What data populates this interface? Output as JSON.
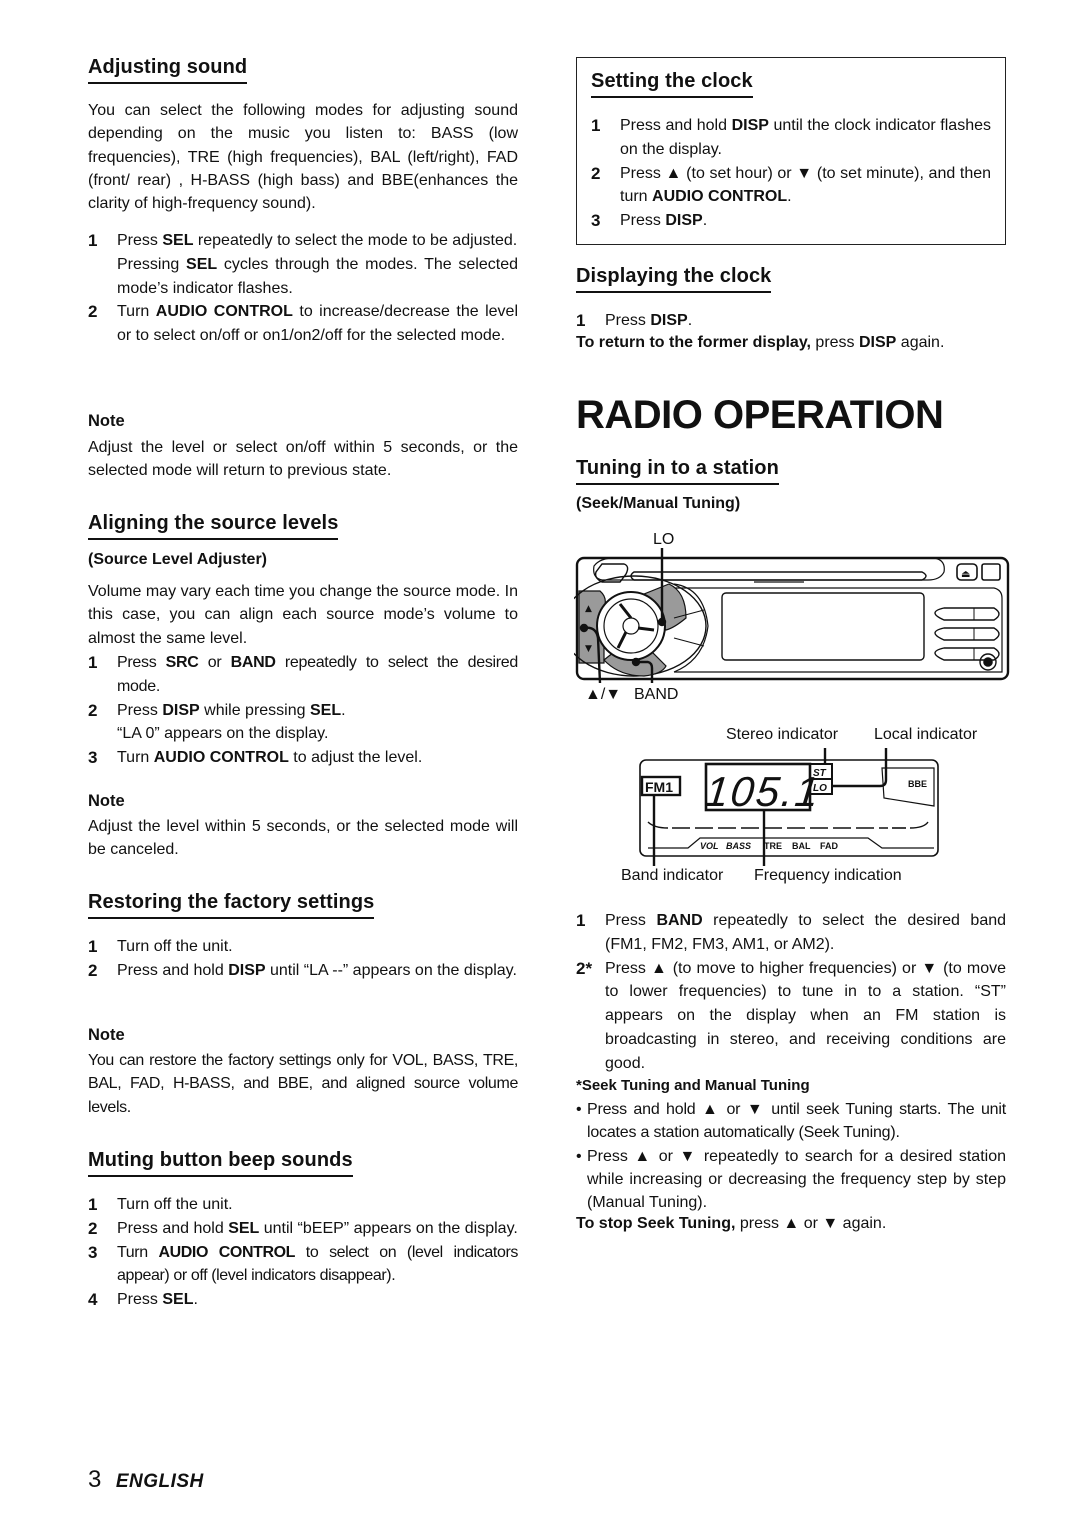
{
  "left": {
    "adjusting_sound": {
      "heading": "Adjusting sound",
      "intro": "You can select the following modes for adjusting sound depending on the music you listen to: BASS (low frequencies), TRE (high frequencies), BAL (left/right), FAD (front/ rear) , H-BASS (high bass) and BBE(enhances the clarity of high-frequency sound).",
      "steps": [
        {
          "num": "1",
          "pre": "Press ",
          "bold": "SEL",
          "post": " repeatedly to select the mode to be adjusted.",
          "extra_pre": "Pressing ",
          "extra_bold": "SEL",
          "extra_post": " cycles through the modes. The selected mode’s indicator flashes."
        },
        {
          "num": "2",
          "pre": "Turn ",
          "bold": "AUDIO CONTROL",
          "post": " to increase/decrease the level or to select on/off or on1/on2/off  for the selected mode."
        }
      ],
      "note_heading": "Note",
      "note_text": "Adjust the level or select on/off within 5 seconds, or the selected mode will return to previous state."
    },
    "aligning": {
      "heading": "Aligning the source levels",
      "subheading": "(Source Level Adjuster)",
      "intro": "Volume may vary each time you change the source mode. In this case, you can align each source mode’s volume to almost the same level.",
      "steps": [
        {
          "num": "1",
          "pre": "Press ",
          "bold": "SRC",
          "mid": " or ",
          "bold2": "BAND",
          "post": " repeatedly to select the desired mode."
        },
        {
          "num": "2",
          "pre": "Press ",
          "bold": "DISP",
          "mid": " while pressing ",
          "bold2": "SEL",
          "post": ".",
          "extra": "“LA 0” appears on the display."
        },
        {
          "num": "3",
          "pre": "Turn ",
          "bold": "AUDIO CONTROL",
          "post": " to adjust the level."
        }
      ],
      "note_heading": "Note",
      "note_text": "Adjust the level within 5 seconds, or the selected mode will be canceled."
    },
    "restoring": {
      "heading": "Restoring the factory settings",
      "steps": [
        {
          "num": "1",
          "text": "Turn off the unit."
        },
        {
          "num": "2",
          "pre": "Press and hold ",
          "bold": "DISP",
          "post": " until “LA --” appears on the display."
        }
      ],
      "note_heading": "Note",
      "note_text": "You can restore the factory settings only for VOL, BASS, TRE, BAL, FAD, H-BASS, and BBE, and aligned source volume levels."
    },
    "muting": {
      "heading": "Muting button beep sounds",
      "steps": [
        {
          "num": "1",
          "text": "Turn off the unit."
        },
        {
          "num": "2",
          "pre": "Press and hold ",
          "bold": "SEL",
          "post": " until “bEEP” appears on the display."
        },
        {
          "num": "3",
          "pre": "Turn ",
          "bold": "AUDIO CONTROL",
          "post": " to select on (level indicators appear) or off (level indicators disappear)."
        },
        {
          "num": "4",
          "pre": "Press ",
          "bold": "SEL",
          "post": "."
        }
      ]
    }
  },
  "right": {
    "setting_clock": {
      "heading": "Setting the clock",
      "steps": [
        {
          "num": "1",
          "pre": "Press and hold ",
          "bold": "DISP",
          "post": " until the clock indicator flashes on the display."
        },
        {
          "num": "2",
          "pre": "Press ",
          "up": "▲",
          "mid": " (to set hour) or ",
          "down": "▼",
          "mid2": " (to set minute), and then  turn ",
          "bold": "AUDIO CONTROL",
          "post": "."
        },
        {
          "num": "3",
          "pre": "Press ",
          "bold": "DISP",
          "post": "."
        }
      ]
    },
    "displaying_clock": {
      "heading": "Displaying the clock",
      "step": {
        "num": "1",
        "pre": "Press ",
        "bold": "DISP",
        "post": "."
      },
      "return_bold": "To return to the former display,",
      "return_mid": " press ",
      "return_bold2": "DISP",
      "return_post": " again."
    },
    "radio_title": "RADIO OPERATION",
    "tuning": {
      "heading": "Tuning in to a station",
      "subheading": "(Seek/Manual Tuning)",
      "figure_labels": {
        "lo": "LO",
        "updown": "▲/▼",
        "band": "BAND",
        "stereo_indicator": "Stereo indicator",
        "local_indicator": "Local indicator",
        "band_indicator": "Band indicator",
        "frequency_indication": "Frequency indication"
      },
      "lcd": {
        "band": "FM1",
        "frequency": "105.1",
        "st": "ST",
        "lo": "LO",
        "bbe": "BBE",
        "levels": [
          "VOL",
          "BASS",
          "TRE",
          "BAL",
          "FAD"
        ]
      },
      "steps": [
        {
          "num": "1",
          "pre": "Press ",
          "bold": "BAND",
          "post": " repeatedly to select the desired band (FM1, FM2, FM3, AM1, or AM2)."
        },
        {
          "num": "2*",
          "pre": "Press ",
          "up": "▲",
          "mid": " (to move to higher frequencies) or ",
          "down": "▼",
          "post": " (to move to lower frequencies) to tune in to a station. “ST” appears on the display when an FM station is broadcasting in stereo, and receiving conditions are good."
        }
      ],
      "seek_heading": "*Seek Tuning and Manual Tuning",
      "bullets": [
        {
          "pre": "Press and hold ",
          "up": "▲",
          "mid": " or ",
          "down": "▼",
          "post": " until seek Tuning starts. The unit locates a station automatically (Seek Tuning)."
        },
        {
          "pre": "Press ",
          "up": "▲",
          "mid": " or ",
          "down": "▼",
          "post": " repeatedly to search for a desired station while increasing or decreasing the frequency step by step (Manual Tuning)."
        }
      ],
      "stop_bold": "To stop Seek Tuning,",
      "stop_pre": " press ",
      "stop_up": "▲",
      "stop_mid": " or ",
      "stop_down": "▼",
      "stop_post": " again."
    }
  },
  "footer": {
    "page_number": "3",
    "language": "ENGLISH"
  }
}
